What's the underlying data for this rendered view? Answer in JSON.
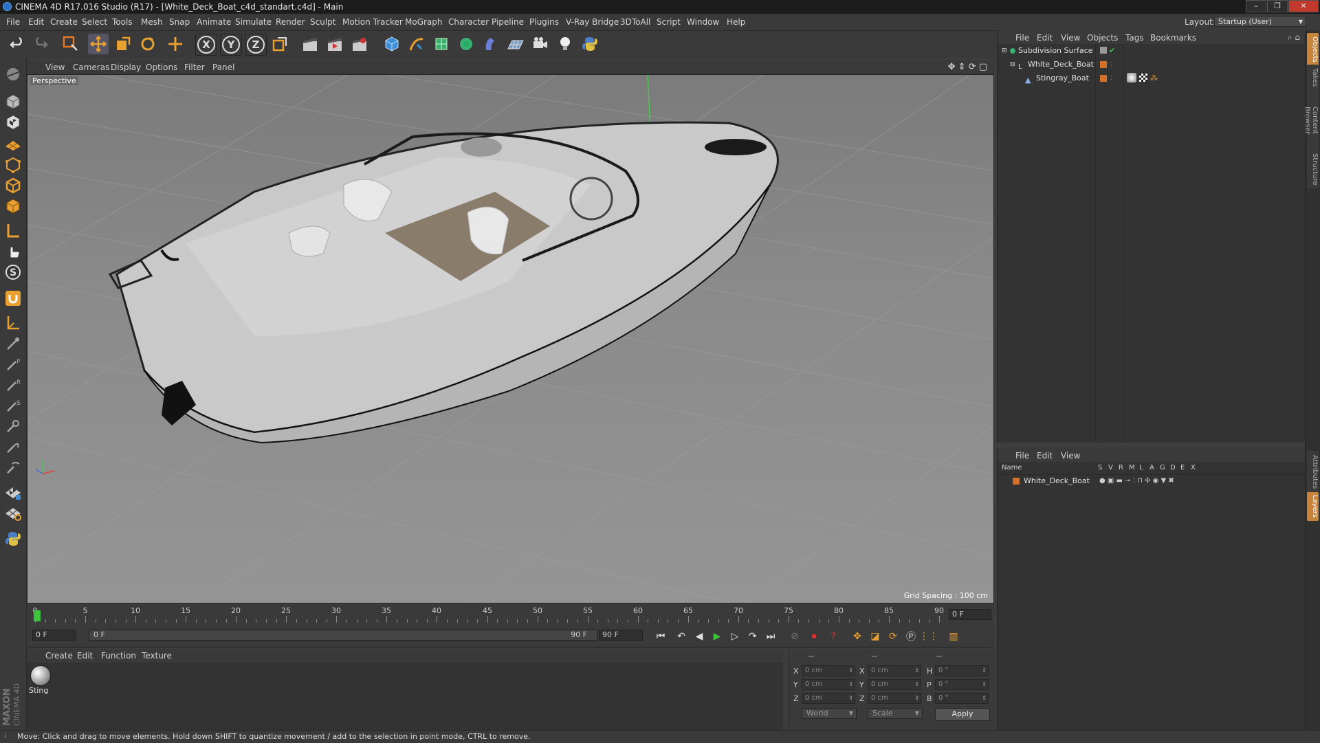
{
  "titlebar": {
    "title": "CINEMA 4D R17.016 Studio (R17) - [White_Deck_Boat_c4d_standart.c4d] - Main",
    "minimize": "–",
    "maximize": "❐",
    "close": "✕"
  },
  "menubar": {
    "items": [
      "File",
      "Edit",
      "Create",
      "Select",
      "Tools",
      "Mesh",
      "Snap",
      "Animate",
      "Simulate",
      "Render",
      "Sculpt",
      "Motion Tracker",
      "MoGraph",
      "Character",
      "Pipeline",
      "Plugins",
      "V-Ray Bridge",
      "3DToAll",
      "Script",
      "Window",
      "Help"
    ],
    "layout_label": "Layout:",
    "layout_value": "Startup (User)"
  },
  "toolbar": {
    "axis_x": "X",
    "axis_y": "Y",
    "axis_z": "Z"
  },
  "viewport": {
    "menu": [
      "View",
      "Cameras",
      "Display",
      "Options",
      "Filter",
      "Panel"
    ],
    "name": "Perspective",
    "grid_spacing": "Grid Spacing : 100 cm"
  },
  "timeline": {
    "labels": [
      "0",
      "5",
      "10",
      "15",
      "20",
      "25",
      "30",
      "35",
      "40",
      "45",
      "50",
      "55",
      "60",
      "65",
      "70",
      "75",
      "80",
      "85",
      "90"
    ],
    "current_frame_field": "0 F",
    "start_field": "0 F",
    "range_start": "0 F",
    "range_end": "90 F",
    "end_field": "90 F"
  },
  "material_manager": {
    "menu": [
      "Create",
      "Edit",
      "Function",
      "Texture"
    ],
    "material_label": "Sting"
  },
  "coordinates": {
    "headers": [
      "--",
      "--",
      "--"
    ],
    "rows": [
      {
        "l1": "X",
        "v1": "0 cm",
        "l2": "X",
        "v2": "0 cm",
        "l3": "H",
        "v3": "0 °"
      },
      {
        "l1": "Y",
        "v1": "0 cm",
        "l2": "Y",
        "v2": "0 cm",
        "l3": "P",
        "v3": "0 °"
      },
      {
        "l1": "Z",
        "v1": "0 cm",
        "l2": "Z",
        "v2": "0 cm",
        "l3": "B",
        "v3": "0 °"
      }
    ],
    "space_dropdown": "World",
    "mode_dropdown": "Scale",
    "apply": "Apply"
  },
  "object_manager": {
    "menu": [
      "File",
      "Edit",
      "View",
      "Objects",
      "Tags",
      "Bookmarks"
    ],
    "objects": [
      "Subdivision Surface",
      "White_Deck_Boat",
      "Stingray_Boat"
    ]
  },
  "layer_manager": {
    "menu": [
      "File",
      "Edit",
      "View"
    ],
    "columns": [
      "Name",
      "S",
      "V",
      "R",
      "M",
      "L",
      "A",
      "G",
      "D",
      "E",
      "X"
    ],
    "layer_name": "White_Deck_Boat",
    "layer_color": "#d2702a"
  },
  "right_tabs": [
    "Objects",
    "Takes",
    "Content Browser",
    "Structure",
    "Attributes",
    "Layers"
  ],
  "brand": {
    "maxon": "MAXON",
    "product": "CINEMA 4D"
  },
  "statusbar": {
    "text": "Move: Click and drag to move elements. Hold down SHIFT to quantize movement / add to the selection in point mode, CTRL to remove."
  },
  "colors": {
    "accent_orange": "#c8843a",
    "selection_blue": "#2a72c8",
    "play_green": "#3fc33f"
  }
}
